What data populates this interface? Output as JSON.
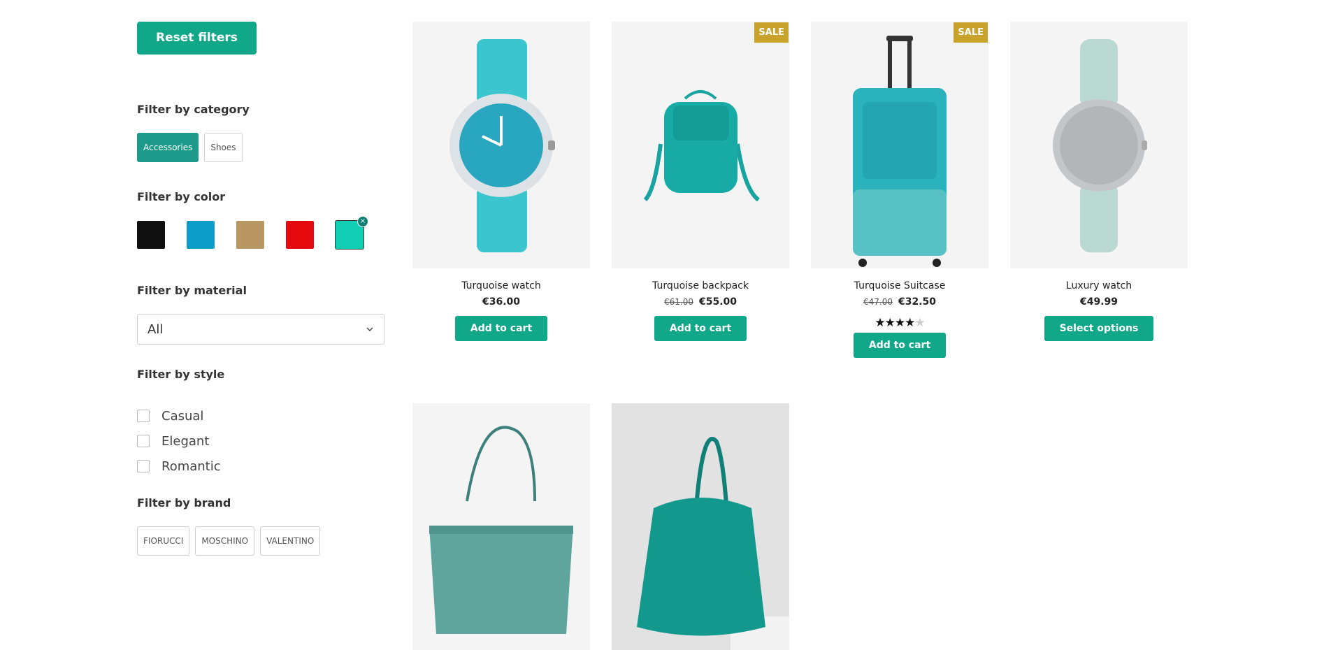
{
  "sidebar": {
    "reset_label": "Reset filters",
    "category": {
      "title": "Filter by category",
      "options": [
        {
          "label": "Accessories",
          "active": true
        },
        {
          "label": "Shoes",
          "active": false
        }
      ]
    },
    "color": {
      "title": "Filter by color",
      "swatches": [
        {
          "color": "#0f0f0f",
          "selected": false
        },
        {
          "color": "#0e9dc6",
          "selected": false
        },
        {
          "color": "#b89762",
          "selected": false
        },
        {
          "color": "#e3090c",
          "selected": false
        },
        {
          "color": "#10cdb4",
          "selected": true
        }
      ],
      "remove_glyph": "×"
    },
    "material": {
      "title": "Filter by material",
      "selected": "All"
    },
    "style": {
      "title": "Filter by style",
      "options": [
        "Casual",
        "Elegant",
        "Romantic"
      ]
    },
    "brand": {
      "title": "Filter by brand",
      "options": [
        "FIORUCCI",
        "MOSCHINO",
        "VALENTINO"
      ]
    }
  },
  "products": [
    {
      "name": "Turquoise watch",
      "price": "€36.00",
      "old_price": "",
      "sale": false,
      "button": "Add to cart",
      "rating": 0
    },
    {
      "name": "Turquoise backpack",
      "price": "€55.00",
      "old_price": "€61.00",
      "sale": true,
      "button": "Add to cart",
      "rating": 0
    },
    {
      "name": "Turquoise Suitcase",
      "price": "€32.50",
      "old_price": "€47.00",
      "sale": true,
      "button": "Add to cart",
      "rating": 4
    },
    {
      "name": "Luxury watch",
      "price": "€49.99",
      "old_price": "",
      "sale": false,
      "button": "Select options",
      "rating": 0
    },
    {
      "name": "",
      "price": "",
      "old_price": "",
      "sale": false,
      "button": "",
      "rating": 0
    },
    {
      "name": "",
      "price": "",
      "old_price": "",
      "sale": false,
      "button": "",
      "rating": 0
    }
  ],
  "badges": {
    "sale": "SALE"
  },
  "colors": {
    "accent": "#11a88a",
    "sale": "#c8a22a",
    "chip_active": "#1e9a8a"
  },
  "icons": [
    "chevron-down-icon",
    "close-icon",
    "star-icon"
  ]
}
